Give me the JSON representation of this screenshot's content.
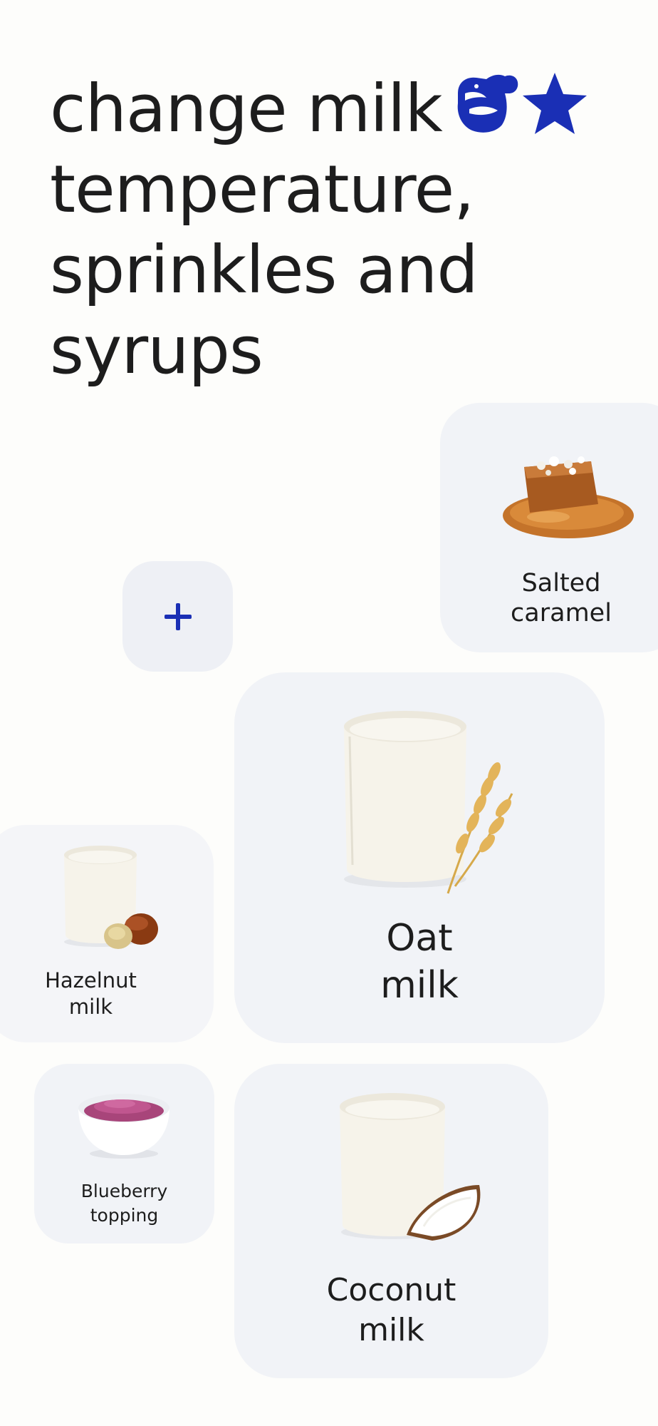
{
  "headline": {
    "lines": [
      "change milk",
      "temperature,",
      "sprinkles and",
      "syrups"
    ],
    "emoji_icons": [
      "milk-jug-icon",
      "star-icon"
    ],
    "accent_color": "#1a2fb5"
  },
  "add_button": {
    "icon": "plus-icon",
    "label": "+"
  },
  "cards": {
    "salted_caramel": {
      "label": "Salted\ncaramel",
      "image": "caramel-icon"
    },
    "oat_milk": {
      "label": "Oat\nmilk",
      "image": "oat-milk-glass-icon"
    },
    "hazelnut_milk": {
      "label": "Hazelnut\nmilk",
      "image": "hazelnut-milk-glass-icon"
    },
    "blueberry_topping": {
      "label": "Blueberry\ntopping",
      "image": "blueberry-powder-bowl-icon"
    },
    "coconut_milk": {
      "label": "Coconut\nmilk",
      "image": "coconut-milk-glass-icon"
    }
  },
  "colors": {
    "background": "#fdfdfb",
    "card": "#f1f3f7",
    "accent": "#1a2fb5",
    "text": "#1d1d1d"
  }
}
